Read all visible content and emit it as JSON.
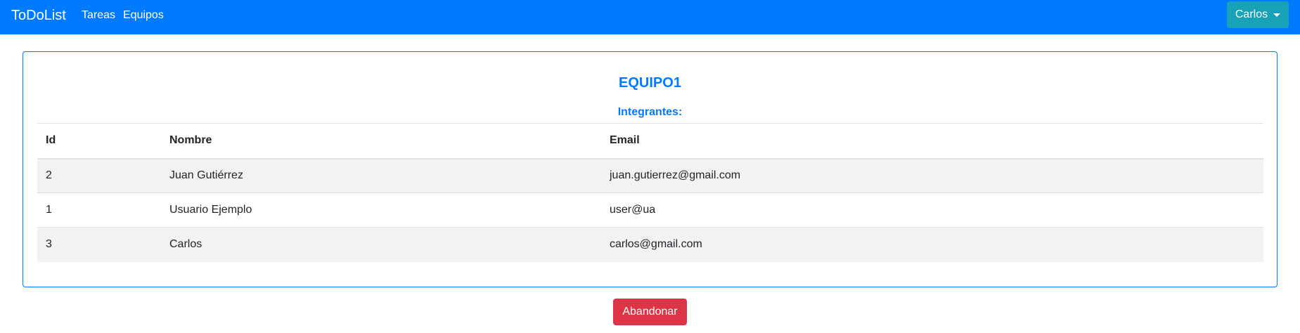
{
  "navbar": {
    "brand": "ToDoList",
    "links": [
      "Tareas",
      "Equipos"
    ],
    "user_label": "Carlos",
    "bg_color": "#007bff",
    "user_btn_color": "#17a2b8"
  },
  "team": {
    "name": "EQUIPO1",
    "members_label": "Integrantes:",
    "table": {
      "headers": [
        "Id",
        "Nombre",
        "Email"
      ],
      "rows": [
        [
          "2",
          "Juan Gutiérrez",
          "juan.gutierrez@gmail.com"
        ],
        [
          "1",
          "Usuario Ejemplo",
          "user@ua"
        ],
        [
          "3",
          "Carlos",
          "carlos@gmail.com"
        ]
      ]
    }
  },
  "actions": {
    "leave_label": "Abandonar",
    "leave_color": "#dc3545"
  }
}
